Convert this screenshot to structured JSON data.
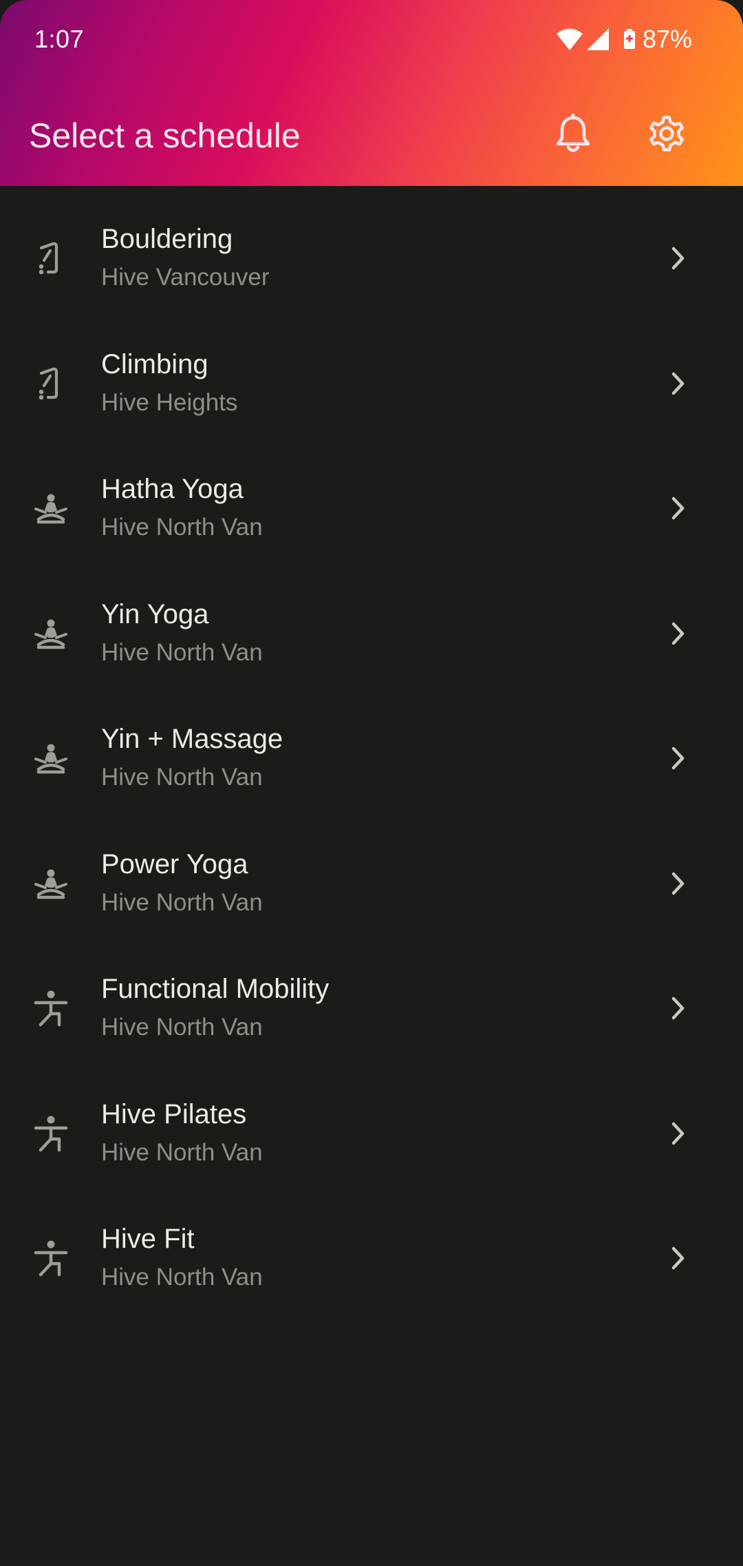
{
  "status_bar": {
    "time": "1:07",
    "battery": "87%",
    "icons": [
      "wifi-icon",
      "cell-signal-icon",
      "battery-icon"
    ]
  },
  "app_bar": {
    "title": "Select a schedule",
    "actions": [
      "bell-icon",
      "gear-icon"
    ]
  },
  "colors": {
    "gradient": [
      "#7b0a6e",
      "#d80d5c",
      "#fb6a34",
      "#ff9418"
    ],
    "background": "#1b1b18",
    "title_text": "#ecebe6",
    "subtitle_text": "#8f8f8a",
    "icon": "#9e9e98"
  },
  "schedules": [
    {
      "title": "Bouldering",
      "subtitle": "Hive Vancouver",
      "icon": "climbing-hold-icon"
    },
    {
      "title": "Climbing",
      "subtitle": "Hive Heights",
      "icon": "climbing-hold-icon"
    },
    {
      "title": "Hatha Yoga",
      "subtitle": "Hive North Van",
      "icon": "meditation-icon"
    },
    {
      "title": "Yin Yoga",
      "subtitle": "Hive North Van",
      "icon": "meditation-icon"
    },
    {
      "title": "Yin + Massage",
      "subtitle": "Hive North Van",
      "icon": "meditation-icon"
    },
    {
      "title": "Power Yoga",
      "subtitle": "Hive North Van",
      "icon": "meditation-icon"
    },
    {
      "title": "Functional Mobility",
      "subtitle": "Hive North Van",
      "icon": "exercise-figure-icon"
    },
    {
      "title": "Hive Pilates",
      "subtitle": "Hive North Van",
      "icon": "exercise-figure-icon"
    },
    {
      "title": "Hive Fit",
      "subtitle": "Hive North Van",
      "icon": "exercise-figure-icon"
    }
  ]
}
